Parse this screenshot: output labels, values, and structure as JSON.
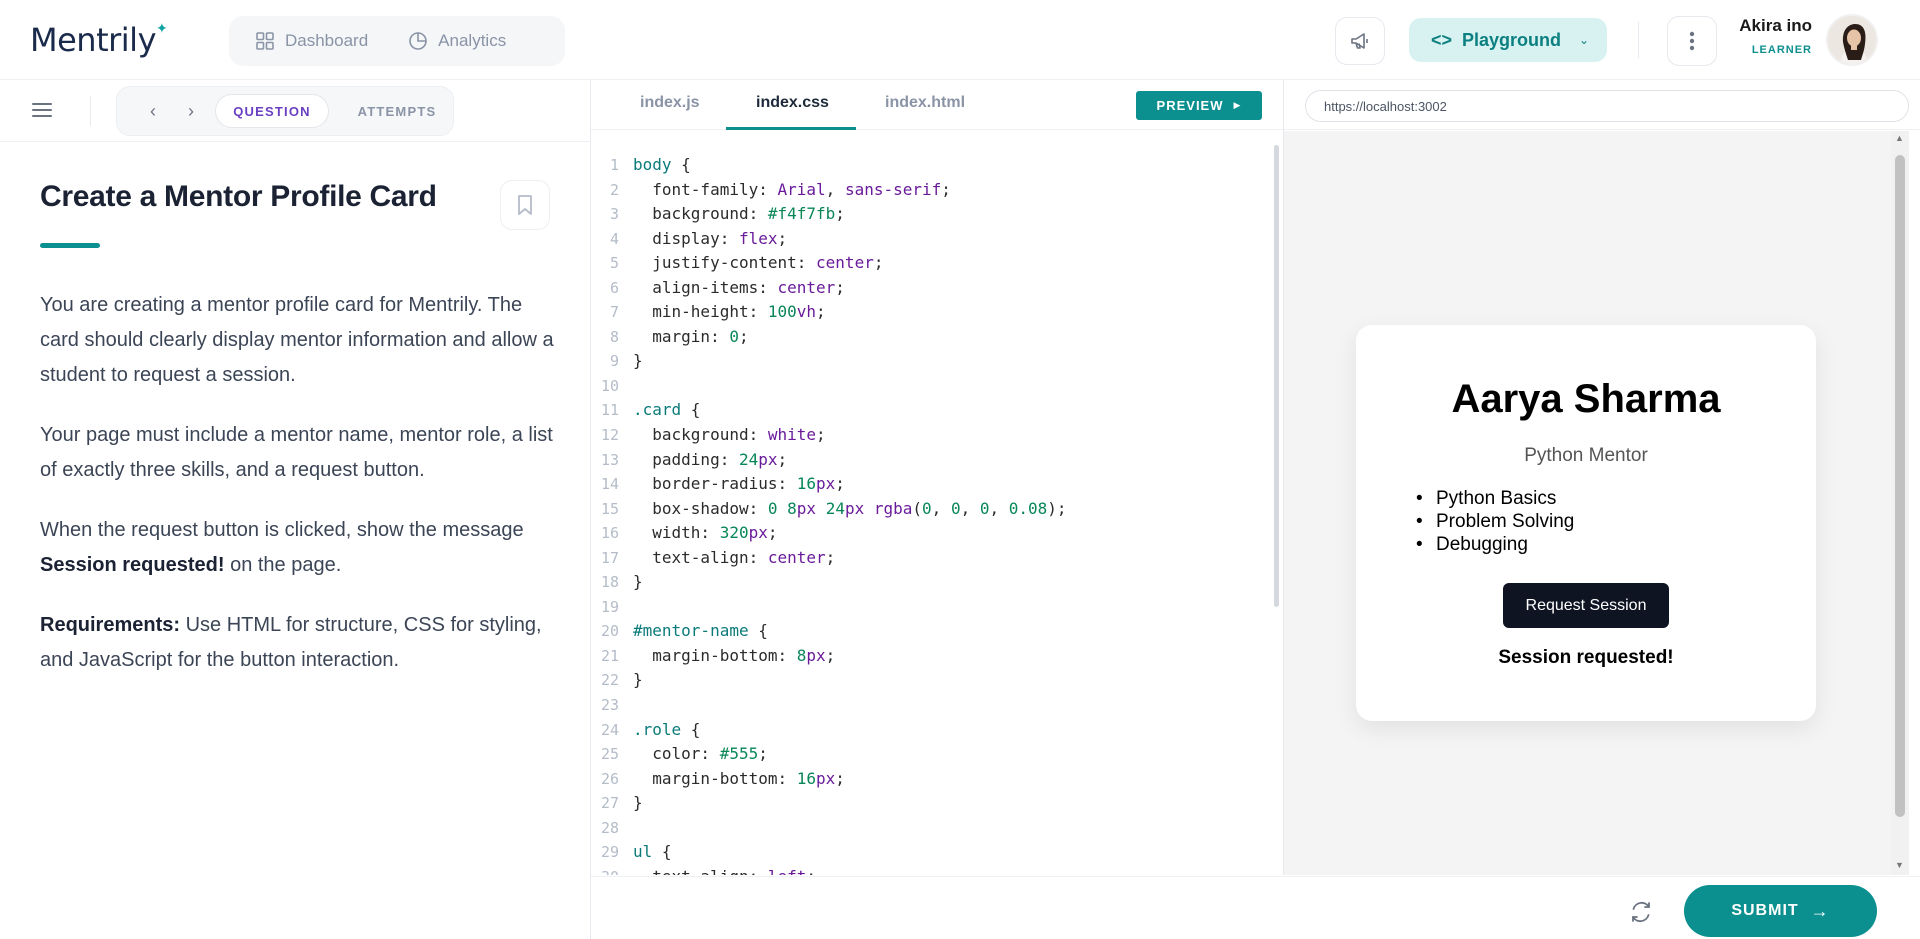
{
  "header": {
    "brand": "Mentrily",
    "nav": [
      {
        "label": "Dashboard",
        "icon": "grid-icon"
      },
      {
        "label": "Analytics",
        "icon": "pie-chart-icon"
      }
    ],
    "playground_label": "Playground",
    "user": {
      "name": "Akira ino",
      "role": "LEARNER"
    }
  },
  "left": {
    "tabs": {
      "question": "QUESTION",
      "attempts": "ATTEMPTS"
    },
    "title": "Create a Mentor Profile Card",
    "para1": "You are creating a mentor profile card for Mentrily. The card should clearly display mentor information and allow a student to request a session.",
    "para2": "Your page must include a mentor name, mentor role, a list of exactly three skills, and a request button.",
    "para3_pre": "When the request button is clicked, show the message ",
    "para3_bold": "Session requested!",
    "para3_post": " on the page.",
    "para4_bold": "Requirements:",
    "para4_post": " Use HTML for structure, CSS for styling, and JavaScript for the button interaction."
  },
  "editor": {
    "tabs": [
      "index.js",
      "index.css",
      "index.html"
    ],
    "active_tab": "index.css",
    "preview_label": "PREVIEW",
    "lines": [
      "body {",
      "  font-family: Arial, sans-serif;",
      "  background: #f4f7fb;",
      "  display: flex;",
      "  justify-content: center;",
      "  align-items: center;",
      "  min-height: 100vh;",
      "  margin: 0;",
      "}",
      "",
      ".card {",
      "  background: white;",
      "  padding: 24px;",
      "  border-radius: 16px;",
      "  box-shadow: 0 8px 24px rgba(0, 0, 0, 0.08);",
      "  width: 320px;",
      "  text-align: center;",
      "}",
      "",
      "#mentor-name {",
      "  margin-bottom: 8px;",
      "}",
      "",
      ".role {",
      "  color: #555;",
      "  margin-bottom: 16px;",
      "}",
      "",
      "ul {",
      "  text-align: left;"
    ]
  },
  "preview": {
    "url": "https://localhost:3002",
    "card": {
      "name": "Aarya Sharma",
      "role": "Python Mentor",
      "skills": [
        "Python Basics",
        "Problem Solving",
        "Debugging"
      ],
      "button": "Request Session",
      "message": "Session requested!"
    }
  },
  "footer": {
    "submit_label": "SUBMIT"
  },
  "colors": {
    "accent": "#0c8f8f",
    "question_tab": "#6a3fc2",
    "playground_bg": "#d7f2f1"
  }
}
